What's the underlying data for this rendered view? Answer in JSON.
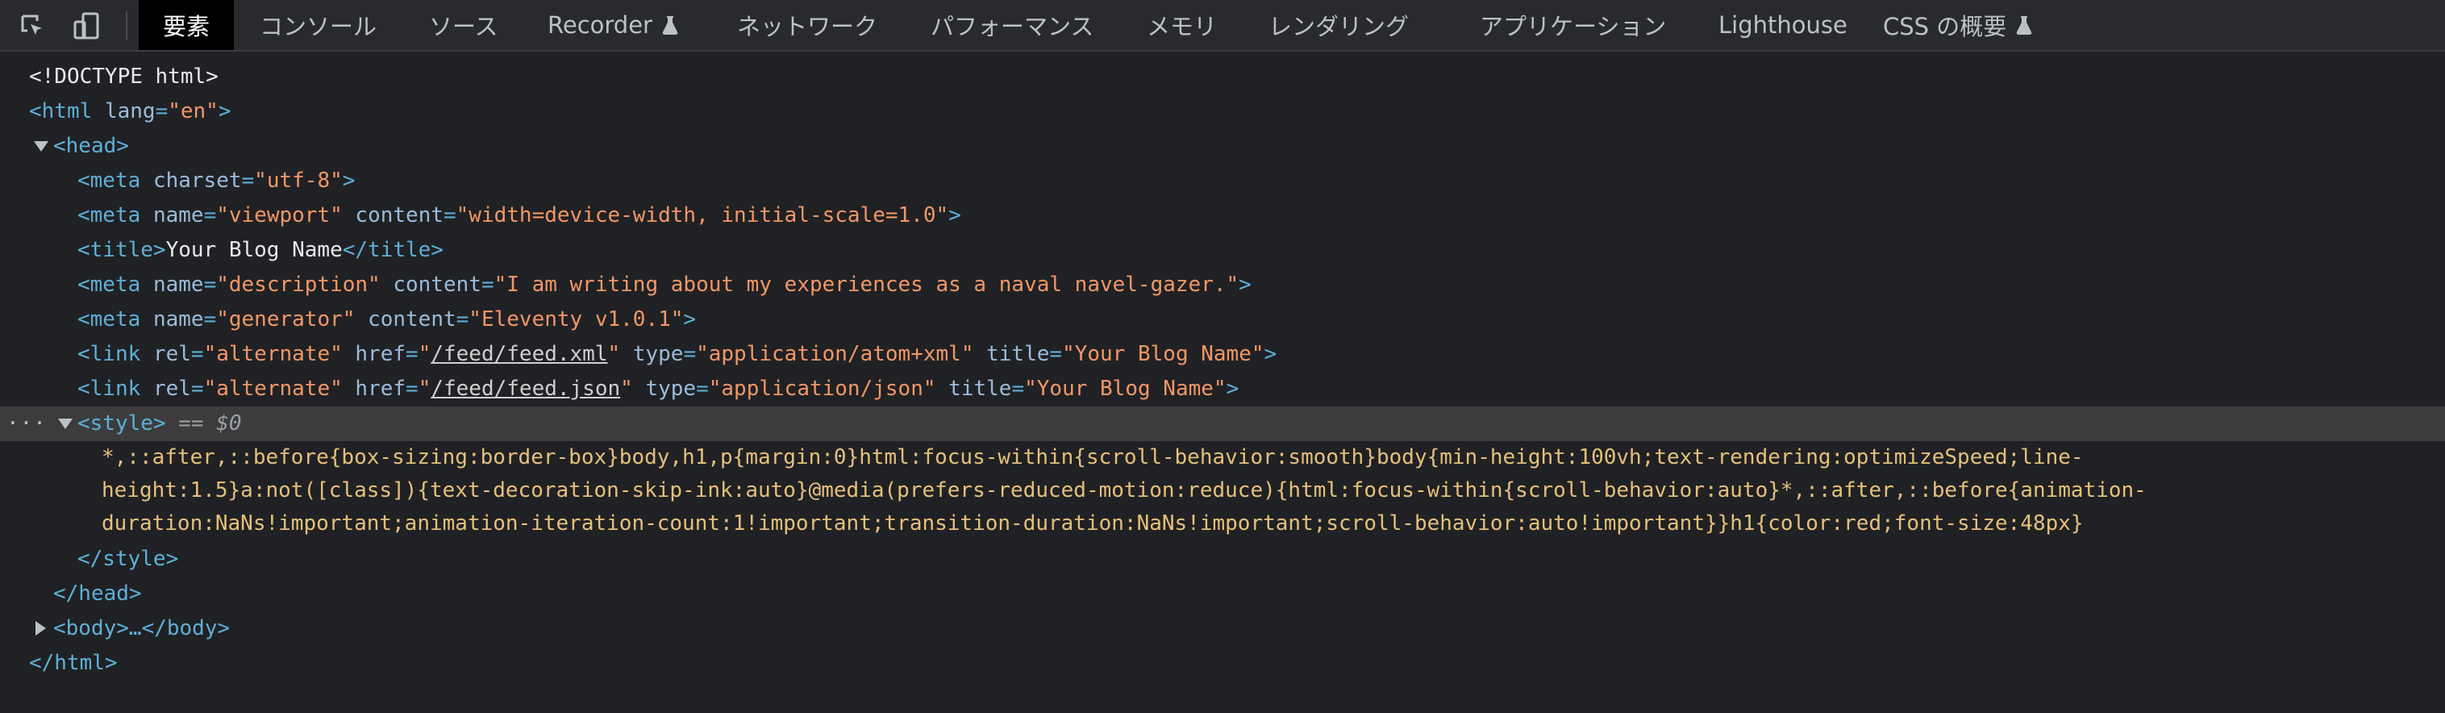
{
  "tabs": [
    {
      "label": "要素",
      "active": true
    },
    {
      "label": "コンソール"
    },
    {
      "label": "ソース"
    },
    {
      "label": "Recorder",
      "experimental": true
    },
    {
      "label": "ネットワーク"
    },
    {
      "label": "パフォーマンス"
    },
    {
      "label": "メモリ"
    },
    {
      "label": "レンダリング"
    },
    {
      "label": "アプリケーション"
    },
    {
      "label": "Lighthouse"
    },
    {
      "label": "CSS の概要",
      "experimental": true
    }
  ],
  "icons": {
    "inspect": "inspect-element-icon",
    "device": "device-toolbar-icon",
    "experimental": "flask-icon"
  },
  "dom": {
    "doctype": "<!DOCTYPE html>",
    "html_open_tag": "<html",
    "html_lang_attr": "lang",
    "html_lang_val": "\"en\"",
    "close_bracket": ">",
    "head_open": "<head>",
    "meta_charset": {
      "open": "<meta",
      "attr": "charset",
      "val": "\"utf-8\""
    },
    "meta_viewport": {
      "open": "<meta",
      "attr1": "name",
      "val1": "\"viewport\"",
      "attr2": "content",
      "val2": "\"width=device-width, initial-scale=1.0\""
    },
    "title": {
      "open": "<title>",
      "text": "Your Blog Name",
      "close": "</title>"
    },
    "meta_description": {
      "open": "<meta",
      "attr1": "name",
      "val1": "\"description\"",
      "attr2": "content",
      "val2": "\"I am writing about my experiences as a naval navel-gazer.\""
    },
    "meta_generator": {
      "open": "<meta",
      "attr1": "name",
      "val1": "\"generator\"",
      "attr2": "content",
      "val2": "\"Eleventy v1.0.1\""
    },
    "link_xml": {
      "open": "<link",
      "rel_attr": "rel",
      "rel_val": "\"alternate\"",
      "href_attr": "href",
      "href_val": "/feed/feed.xml",
      "type_attr": "type",
      "type_val": "\"application/atom+xml\"",
      "title_attr": "title",
      "title_val": "\"Your Blog Name\""
    },
    "link_json": {
      "open": "<link",
      "rel_attr": "rel",
      "rel_val": "\"alternate\"",
      "href_attr": "href",
      "href_val": "/feed/feed.json",
      "type_attr": "type",
      "type_val": "\"application/json\"",
      "title_attr": "title",
      "title_val": "\"Your Blog Name\""
    },
    "style_open": "<style>",
    "selected_marker": "== $0",
    "selected_dots": "···",
    "css_line1": "*,::after,::before{box-sizing:border-box}body,h1,p{margin:0}html:focus-within{scroll-behavior:smooth}body{min-height:100vh;text-rendering:optimizeSpeed;line-",
    "css_line2": "height:1.5}a:not([class]){text-decoration-skip-ink:auto}@media(prefers-reduced-motion:reduce){html:focus-within{scroll-behavior:auto}*,::after,::before{animation-",
    "css_line3": "duration:NaNs!important;animation-iteration-count:1!important;transition-duration:NaNs!important;scroll-behavior:auto!important}}h1{color:red;font-size:48px}",
    "style_close": "</style>",
    "head_close": "</head>",
    "body_collapsed": "<body>…</body>",
    "html_close": "</html>"
  }
}
